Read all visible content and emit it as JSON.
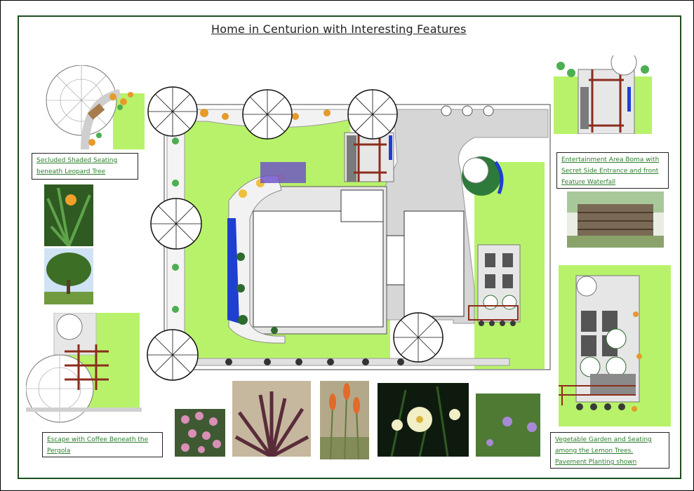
{
  "title": "Home in Centurion with Interesting Features",
  "captions": {
    "secluded": "Secluded Shaded Seating beneath Leopard Tree",
    "entertainment": "Entertainment Area Boma with Secret Side Entrance and front Feature Waterfall",
    "escape": "Escape with Coffee Beneath the Pergola",
    "vegetable": "Vegetable Garden and Seating among the Lemon Trees. Pavement Planting shown"
  },
  "photos": [
    "clivia-photo",
    "leopard-tree-photo",
    "waterfall-photo",
    "pink-flower-photo",
    "phormium-photo",
    "red-hot-poker-photo",
    "white-flower-photo",
    "purple-flower-photo"
  ],
  "colors": {
    "lawn": "#b8f26a",
    "paving": "#d6d6d6",
    "frame": "#1f4e1f",
    "caption_text": "#2e7d2e",
    "pond": "#1f3fd0"
  }
}
